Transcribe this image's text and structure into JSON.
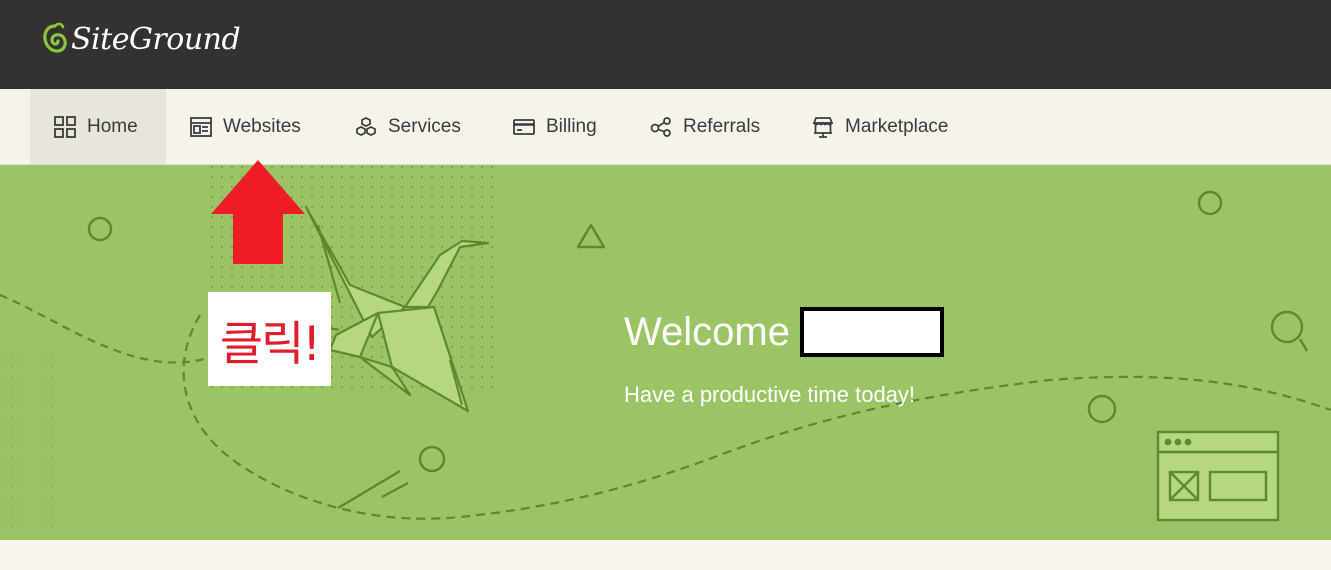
{
  "brand": {
    "logo_text": "SiteGround",
    "logo_icon": "siteground-swirl-icon"
  },
  "nav": {
    "items": [
      {
        "label": "Home",
        "icon": "grid-icon",
        "active": true
      },
      {
        "label": "Websites",
        "icon": "browser-window-icon",
        "active": false
      },
      {
        "label": "Services",
        "icon": "cubes-icon",
        "active": false
      },
      {
        "label": "Billing",
        "icon": "credit-card-icon",
        "active": false
      },
      {
        "label": "Referrals",
        "icon": "share-icon",
        "active": false
      },
      {
        "label": "Marketplace",
        "icon": "storefront-icon",
        "active": false
      }
    ]
  },
  "hero": {
    "welcome": "Welcome",
    "subtitle": "Have a productive time today!"
  },
  "annotation": {
    "label": "클릭!",
    "arrow": "up-arrow-icon"
  },
  "colors": {
    "topbar": "#333231",
    "navbar": "#f5f3ea",
    "hero": "#9bc465",
    "hero_line": "#5f8a2c",
    "annotation_red": "#e01d2b"
  }
}
